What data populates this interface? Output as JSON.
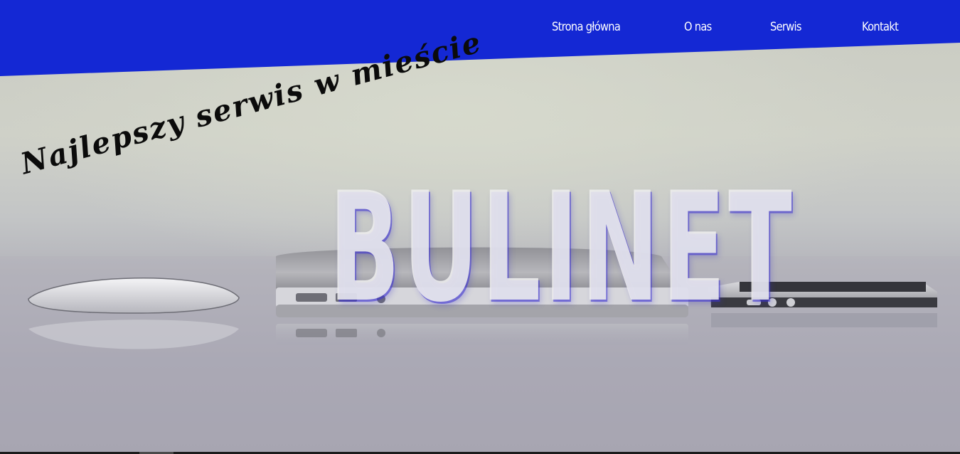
{
  "header": {
    "bg_color": "#1428d4"
  },
  "nav": {
    "items": [
      {
        "label": "Strona główna"
      },
      {
        "label": "O nas"
      },
      {
        "label": "Serwis"
      },
      {
        "label": "Kontakt"
      }
    ]
  },
  "hero": {
    "brand": "BULINET",
    "tagline": "Najlepszy serwis w mieście"
  }
}
